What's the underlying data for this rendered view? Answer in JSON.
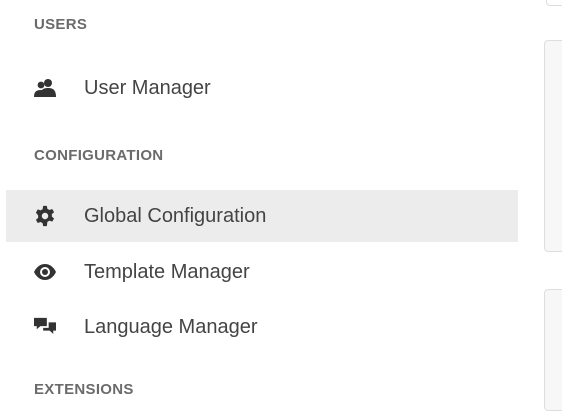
{
  "sidebar": {
    "sections": [
      {
        "header": "USERS",
        "items": [
          {
            "label": "User Manager",
            "icon": "users-icon",
            "active": false
          }
        ]
      },
      {
        "header": "CONFIGURATION",
        "items": [
          {
            "label": "Global Configuration",
            "icon": "gear-icon",
            "active": true
          },
          {
            "label": "Template Manager",
            "icon": "eye-icon",
            "active": false
          },
          {
            "label": "Language Manager",
            "icon": "comments-icon",
            "active": false
          }
        ]
      },
      {
        "header": "EXTENSIONS",
        "items": []
      }
    ]
  },
  "colors": {
    "section_header": "#6b6b6b",
    "item_text": "#444444",
    "icon": "#333333",
    "active_background": "#ececec",
    "panel_border": "#dedede"
  }
}
